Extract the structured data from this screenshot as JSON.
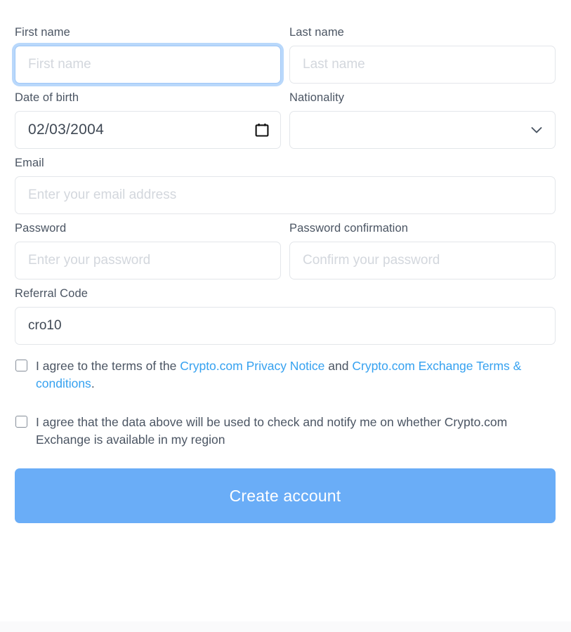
{
  "form": {
    "first_name": {
      "label": "First name",
      "placeholder": "First name",
      "value": ""
    },
    "last_name": {
      "label": "Last name",
      "placeholder": "Last name",
      "value": ""
    },
    "date_of_birth": {
      "label": "Date of birth",
      "value": "02/03/2004",
      "icon": "calendar-icon"
    },
    "nationality": {
      "label": "Nationality",
      "value": "",
      "icon": "chevron-down-icon"
    },
    "email": {
      "label": "Email",
      "placeholder": "Enter your email address",
      "value": ""
    },
    "password": {
      "label": "Password",
      "placeholder": "Enter your password",
      "value": ""
    },
    "password_confirmation": {
      "label": "Password confirmation",
      "placeholder": "Confirm your password",
      "value": ""
    },
    "referral_code": {
      "label": "Referral Code",
      "placeholder": "",
      "value": "cro10"
    }
  },
  "consents": {
    "terms": {
      "text_before": "I agree to the terms of the ",
      "link1": "Crypto.com Privacy Notice",
      "text_middle": " and ",
      "link2": "Crypto.com Exchange Terms & conditions",
      "text_after": ".",
      "checked": false
    },
    "region_check": {
      "text": "I agree that the data above will be used to check and notify me on whether Crypto.com Exchange is available in my region",
      "checked": false
    }
  },
  "actions": {
    "submit_label": "Create account"
  },
  "colors": {
    "accent_blue": "#6aadf7",
    "link_blue": "#35a1f0",
    "focus_ring": "#b9d8fb",
    "label_gray": "#4b5563",
    "placeholder_gray": "#d3d7dd",
    "border_gray": "#e3e6ea",
    "footer_gray": "#fafafb"
  }
}
